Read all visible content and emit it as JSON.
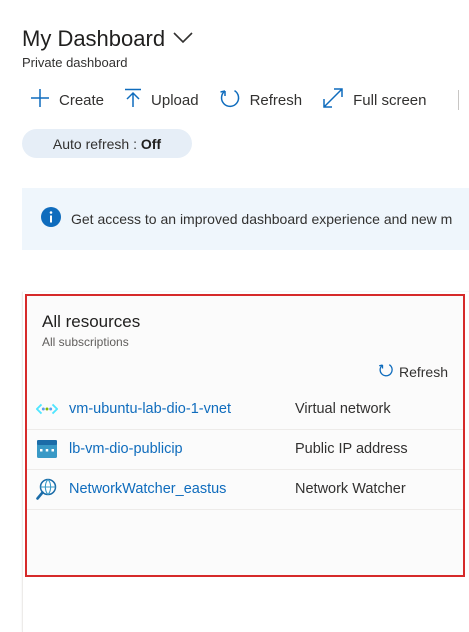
{
  "header": {
    "title": "My Dashboard",
    "subtitle": "Private dashboard"
  },
  "toolbar": {
    "create_label": "Create",
    "upload_label": "Upload",
    "refresh_label": "Refresh",
    "fullscreen_label": "Full screen"
  },
  "auto_refresh": {
    "label": "Auto refresh :",
    "value": "Off"
  },
  "banner": {
    "text": "Get access to an improved dashboard experience and new m"
  },
  "tile": {
    "title": "All resources",
    "subtitle": "All subscriptions",
    "refresh_label": "Refresh",
    "resources": [
      {
        "name": "vm-ubuntu-lab-dio-1-vnet",
        "type": "Virtual network",
        "icon": "virtual-network-icon"
      },
      {
        "name": "lb-vm-dio-publicip",
        "type": "Public IP address",
        "icon": "public-ip-icon"
      },
      {
        "name": "NetworkWatcher_eastus",
        "type": "Network Watcher",
        "icon": "network-watcher-icon"
      }
    ]
  },
  "colors": {
    "accent": "#0f6cbd",
    "highlight_border": "#d62a2a",
    "pill_bg": "#e6eef7",
    "banner_bg": "#eff6fc"
  }
}
